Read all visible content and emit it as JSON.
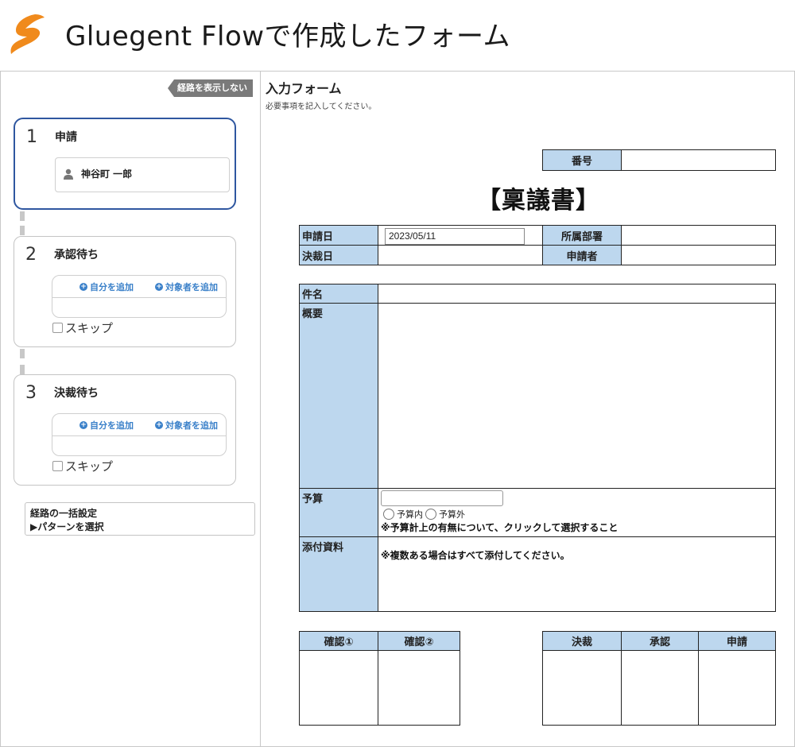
{
  "header": {
    "title": "Gluegent Flowで作成したフォーム",
    "logo_icon": "gluegent-lightning-logo",
    "logo_color": "#f08a1c"
  },
  "route_panel": {
    "hide_route_label": "経路を表示しない",
    "steps": [
      {
        "number": "1",
        "title": "申請",
        "person": "神谷町 一郎"
      },
      {
        "number": "2",
        "title": "承認待ち",
        "add_self": "自分を追加",
        "add_target": "対象者を追加",
        "skip": "スキップ"
      },
      {
        "number": "3",
        "title": "決裁待ち",
        "add_self": "自分を追加",
        "add_target": "対象者を追加",
        "skip": "スキップ"
      }
    ],
    "bulk": {
      "title": "経路の一括設定",
      "pattern": "▶パターンを選択"
    },
    "active_color": "#2f57a0"
  },
  "form": {
    "title": "入力フォーム",
    "subtitle": "必要事項を記入してください。",
    "number_label": "番号",
    "number_value": "",
    "doc_title": "【稟議書】",
    "apply_date_label": "申請日",
    "apply_date_value": "2023/05/11",
    "department_label": "所属部署",
    "department_value": "",
    "decision_date_label": "決裁日",
    "decision_date_value": "",
    "applicant_label": "申請者",
    "applicant_value": "",
    "subject_label": "件名",
    "subject_value": "",
    "summary_label": "概要",
    "summary_value": "",
    "budget_label": "予算",
    "budget_in": "予算内",
    "budget_out": "予算外",
    "budget_note": "※予算計上の有無について、クリックして選択すること",
    "attachments_label": "添付資料",
    "attachments_note": "※複数ある場合はすべて添付してください。",
    "confirm1": "確認①",
    "confirm2": "確認②",
    "decision": "決裁",
    "approval": "承認",
    "application": "申請",
    "label_color": "#bdd7ee"
  }
}
